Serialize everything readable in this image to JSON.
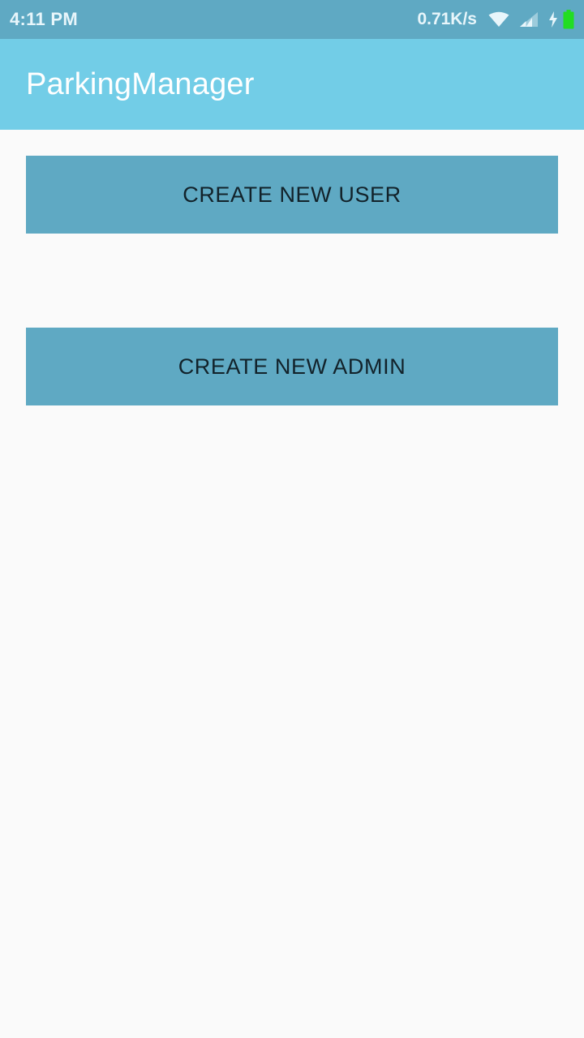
{
  "status_bar": {
    "time": "4:11 PM",
    "net_speed": "0.71K/s",
    "icons": [
      "wifi-icon",
      "signal-icon",
      "charging-icon",
      "battery-icon"
    ],
    "battery_color": "#22dd22"
  },
  "app_bar": {
    "title": "ParkingManager",
    "color": "#72cde7"
  },
  "main": {
    "create_user_label": "CREATE NEW USER",
    "create_admin_label": "CREATE NEW ADMIN",
    "button_color": "#5fa9c3"
  }
}
